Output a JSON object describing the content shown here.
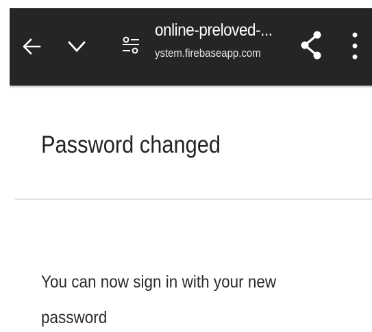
{
  "toolbar": {
    "title": "online-preloved-...",
    "url": "ystem.firebaseapp.com",
    "back_icon": "arrow-back-icon",
    "chevron_icon": "chevron-down-icon",
    "tune_icon": "page-info-icon",
    "share_icon": "share-icon",
    "menu_icon": "more-vert-icon",
    "background_color": "#252525"
  },
  "content": {
    "heading": "Password changed",
    "message": "You can now sign in with your new password"
  }
}
